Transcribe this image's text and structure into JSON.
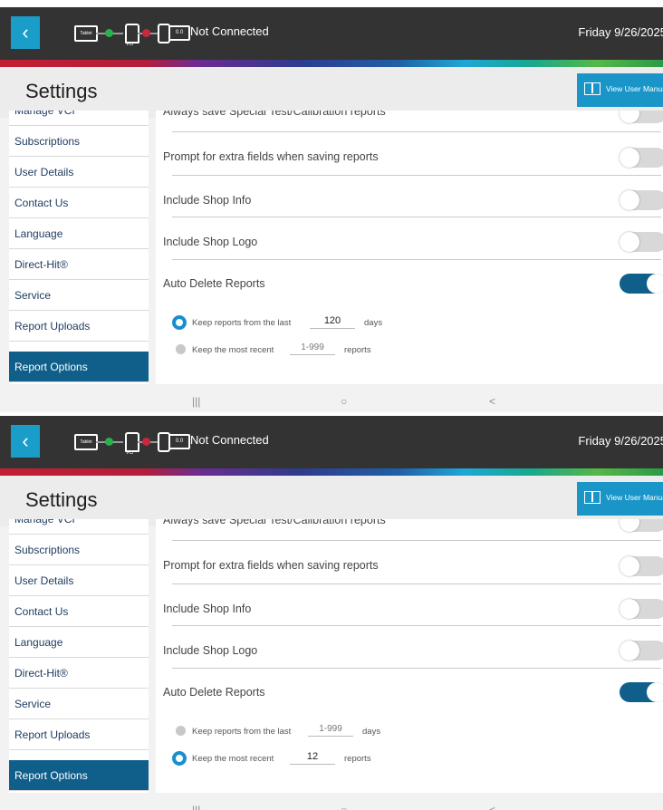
{
  "colors": {
    "accent": "#1a95c8",
    "active_nav": "#0f5f8a",
    "header_bg": "#333333"
  },
  "screens": [
    {
      "header": {
        "back_icon": "chevron-left-icon",
        "connection": {
          "tablet_label": "Tablet",
          "vci_label": "VCI",
          "battery_label": "0.0",
          "status": "Not Connected"
        },
        "date": "Friday 9/26/2025"
      },
      "title_bar": {
        "title": "Settings",
        "manual_button": "View User Manual",
        "manual_icon": "book-icon"
      },
      "sidebar": {
        "items": [
          {
            "label": "Manage VCI"
          },
          {
            "label": "Subscriptions"
          },
          {
            "label": "User Details"
          },
          {
            "label": "Contact Us"
          },
          {
            "label": "Language"
          },
          {
            "label": "Direct-Hit®"
          },
          {
            "label": "Service"
          },
          {
            "label": "Report Uploads"
          },
          {
            "label": "Report Options"
          }
        ],
        "active": "Report Options"
      },
      "content": {
        "rows": [
          {
            "label": "Always save Special Test/Calibration reports",
            "enabled": false
          },
          {
            "label": "Prompt for extra fields when saving reports",
            "enabled": false
          },
          {
            "label": "Include Shop Info",
            "enabled": false
          },
          {
            "label": "Include Shop Logo",
            "enabled": false
          },
          {
            "label": "Auto Delete Reports",
            "enabled": true
          }
        ],
        "options": [
          {
            "prefix": "Keep reports from the last",
            "value": "120",
            "suffix": "days",
            "selected": true
          },
          {
            "prefix": "Keep the most recent",
            "value": "1-999",
            "suffix": "reports",
            "selected": false
          }
        ]
      },
      "navbar": {
        "recents": "|||",
        "home": "○",
        "back": "<"
      }
    },
    {
      "header": {
        "back_icon": "chevron-left-icon",
        "connection": {
          "tablet_label": "Tablet",
          "vci_label": "VCI",
          "battery_label": "0.0",
          "status": "Not Connected"
        },
        "date": "Friday 9/26/2025"
      },
      "title_bar": {
        "title": "Settings",
        "manual_button": "View User Manual",
        "manual_icon": "book-icon"
      },
      "sidebar": {
        "items": [
          {
            "label": "Manage VCI"
          },
          {
            "label": "Subscriptions"
          },
          {
            "label": "User Details"
          },
          {
            "label": "Contact Us"
          },
          {
            "label": "Language"
          },
          {
            "label": "Direct-Hit®"
          },
          {
            "label": "Service"
          },
          {
            "label": "Report Uploads"
          },
          {
            "label": "Report Options"
          }
        ],
        "active": "Report Options"
      },
      "content": {
        "rows": [
          {
            "label": "Always save Special Test/Calibration reports",
            "enabled": false
          },
          {
            "label": "Prompt for extra fields when saving reports",
            "enabled": false
          },
          {
            "label": "Include Shop Info",
            "enabled": false
          },
          {
            "label": "Include Shop Logo",
            "enabled": false
          },
          {
            "label": "Auto Delete Reports",
            "enabled": true
          }
        ],
        "options": [
          {
            "prefix": "Keep reports from the last",
            "value": "1-999",
            "suffix": "days",
            "selected": false
          },
          {
            "prefix": "Keep the most recent",
            "value": "12",
            "suffix": "reports",
            "selected": true
          }
        ]
      },
      "navbar": {
        "recents": "|||",
        "home": "○",
        "back": "<"
      }
    }
  ]
}
